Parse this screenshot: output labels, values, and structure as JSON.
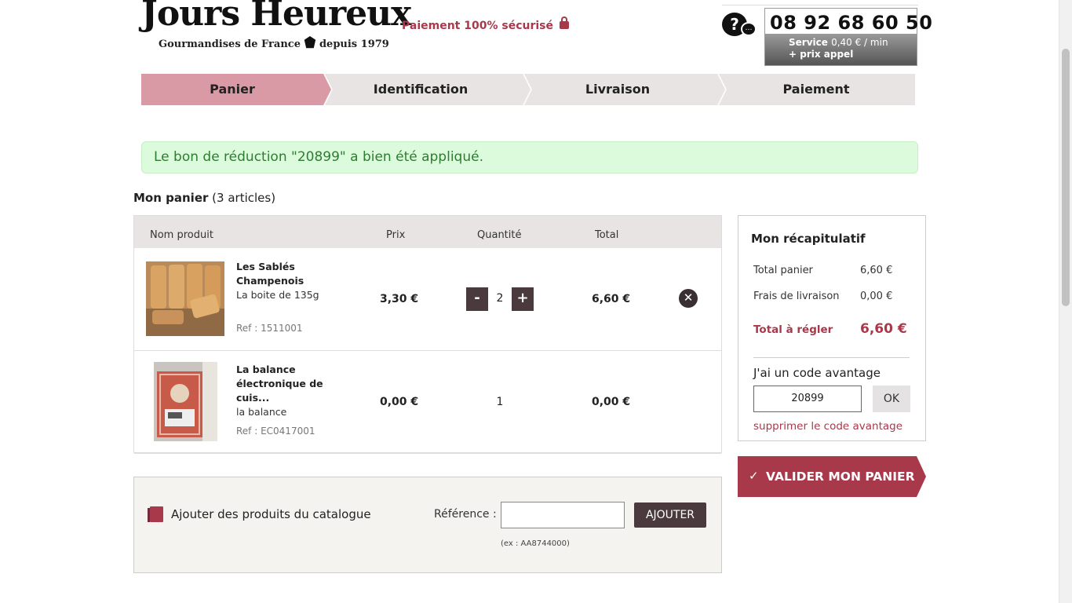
{
  "header": {
    "logo_title": "Jours Heureux",
    "logo_sub_left": "Gourmandises de France",
    "logo_sub_right": "depuis 1979",
    "secure_text": "Paiement 100% sécurisé",
    "phone_number": "08 92 68 60 50",
    "phone_service_line1": "Service",
    "phone_service_price": "0,40 € / min",
    "phone_service_line2": "+ prix appel"
  },
  "steps": [
    {
      "label": "Panier",
      "active": true
    },
    {
      "label": "Identification",
      "active": false
    },
    {
      "label": "Livraison",
      "active": false
    },
    {
      "label": "Paiement",
      "active": false
    }
  ],
  "alert": {
    "text": "Le bon de réduction \"20899\" a bien été appliqué."
  },
  "cart": {
    "title": "Mon panier",
    "count": "(3 articles)",
    "columns": {
      "name": "Nom produit",
      "price": "Prix",
      "quantity": "Quantité",
      "total": "Total"
    },
    "items": [
      {
        "name": "Les Sablés Champenois",
        "desc": "La boite de 135g",
        "ref": "Ref : 1511001",
        "price": "3,30 €",
        "qty_minus": "-",
        "quantity": "2",
        "qty_plus": "+",
        "total": "6,60 €",
        "remove": "✕"
      },
      {
        "name": "La balance électronique de cuis...",
        "desc": "la balance",
        "ref": "Ref : EC0417001",
        "price": "0,00 €",
        "quantity": "1",
        "total": "0,00 €"
      }
    ]
  },
  "catalog": {
    "title": "Ajouter des produits du catalogue",
    "ref_label": "Référence :",
    "ref_placeholder": "",
    "add_button": "AJOUTER",
    "hint": "(ex : AA8744000)"
  },
  "summary": {
    "title": "Mon récapitulatif",
    "cart_total_label": "Total panier",
    "cart_total_value": "6,60 €",
    "shipping_label": "Frais de livraison",
    "shipping_value": "0,00 €",
    "grand_total_label": "Total à régler",
    "grand_total_value": "6,60 €",
    "advantage_title": "J'ai un code avantage",
    "advantage_code": "20899",
    "ok_button": "OK",
    "remove_code": "supprimer le code avantage"
  },
  "validate": {
    "check": "✓",
    "label": "VALIDER MON PANIER"
  },
  "colors": {
    "brand": "#a8394b",
    "active_step": "#d99aa5",
    "dark_button": "#4a3a3d",
    "success_bg": "#dcfadc",
    "success_text": "#2e7d32"
  }
}
